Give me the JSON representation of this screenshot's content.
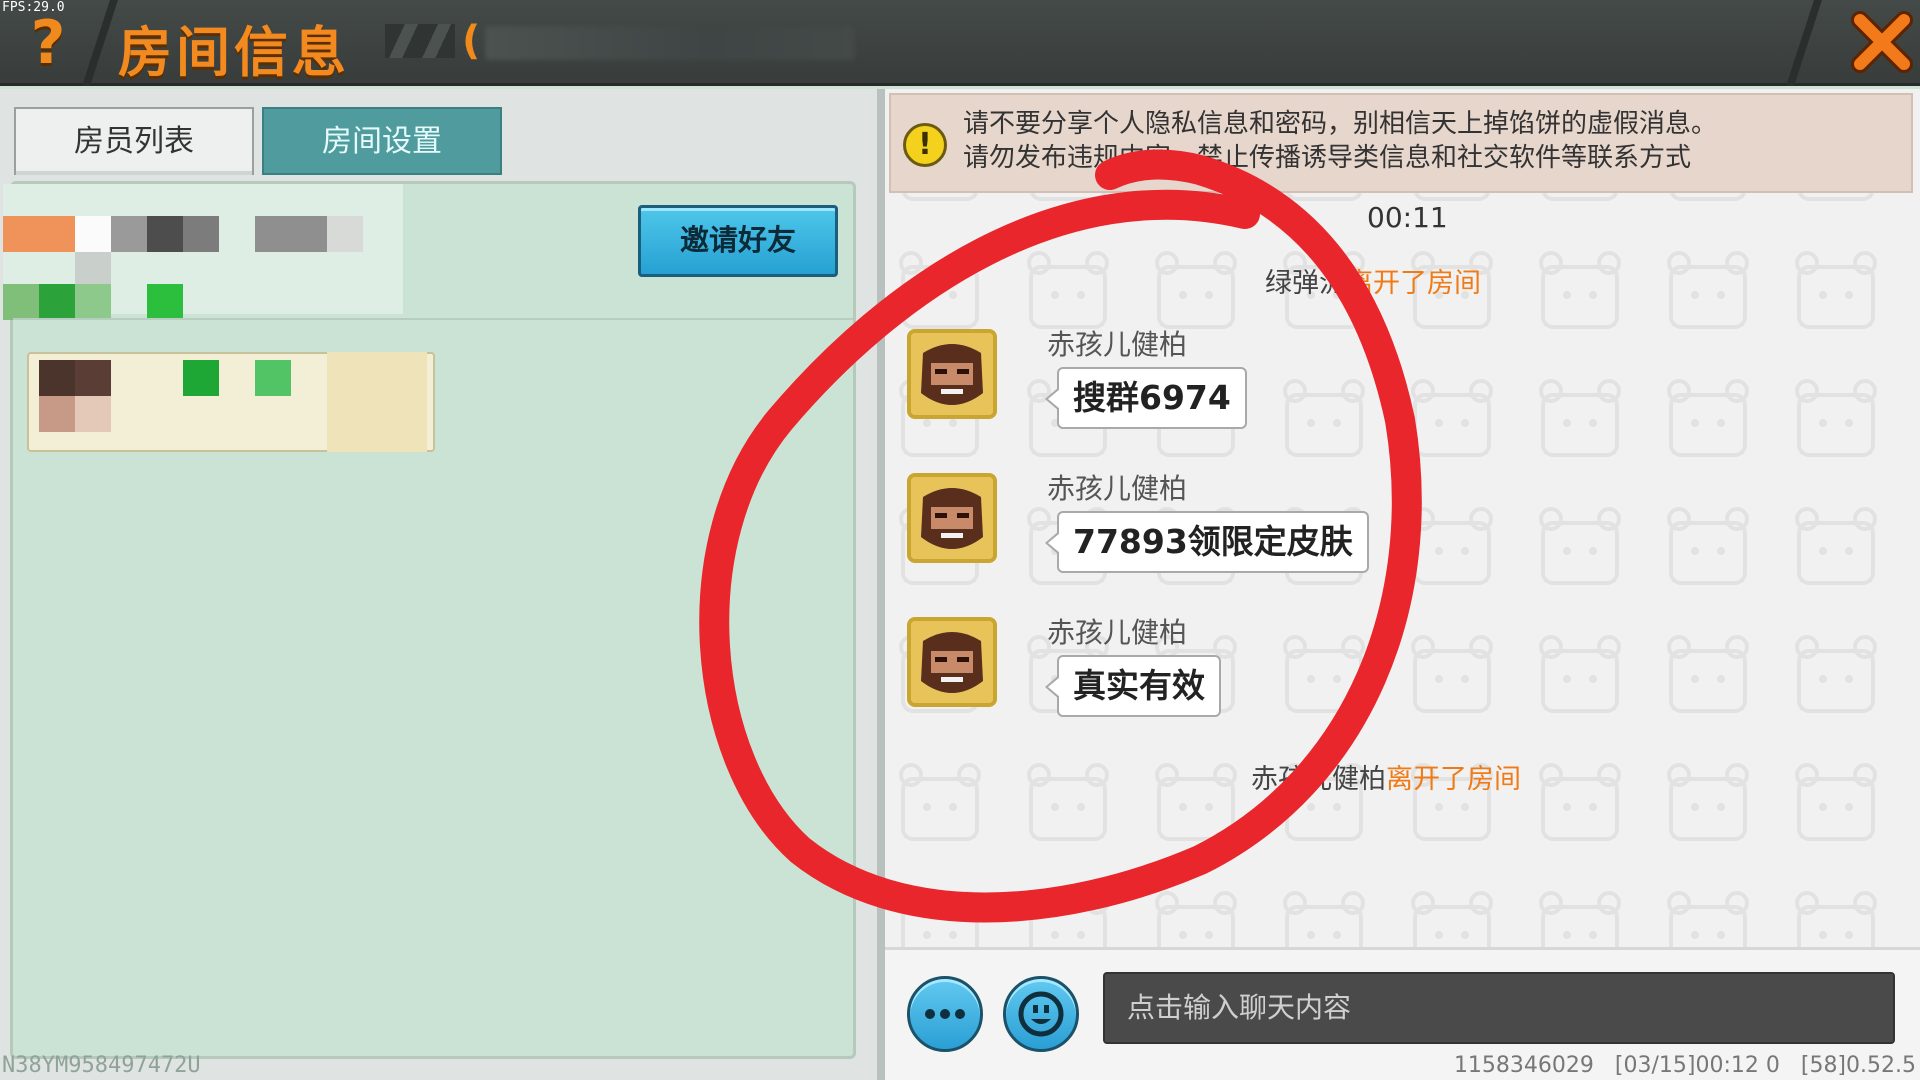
{
  "debug": {
    "fps": "FPS:29.0"
  },
  "header": {
    "help_glyph": "?",
    "title": "房间信息",
    "room_id_prefix": "(",
    "close_glyph": "✕"
  },
  "tabs": [
    {
      "label": "房员列表"
    },
    {
      "label": "房间设置"
    }
  ],
  "members": {
    "invite_button": "邀请好友"
  },
  "device_id": "N38YM958497472U",
  "warning": {
    "line1": "请不要分享个人隐私信息和密码，别相信天上掉馅饼的虚假消息。",
    "line2": "请勿发布违规内容，禁止传播诱导类信息和社交软件等联系方式"
  },
  "chat": {
    "timestamp": "00:11",
    "system_messages": [
      {
        "user": "绿弹流",
        "action": "离开了房间"
      },
      {
        "user": "赤孩儿健柏",
        "action": "离开了房间"
      }
    ],
    "messages": [
      {
        "sender": "赤孩儿健柏",
        "text": "搜群6974"
      },
      {
        "sender": "赤孩儿健柏",
        "text": "77893领限定皮肤"
      },
      {
        "sender": "赤孩儿健柏",
        "text": "真实有效"
      }
    ],
    "input_placeholder": "点击输入聊天内容"
  },
  "footer": {
    "uin": "1158346029",
    "time": "[03/15]00:12 0",
    "version": "[58]0.52.5"
  },
  "colors": {
    "accent_orange": "#f28a20",
    "tab_active": "#4f9b9e",
    "annotation_red": "#e8262b"
  }
}
